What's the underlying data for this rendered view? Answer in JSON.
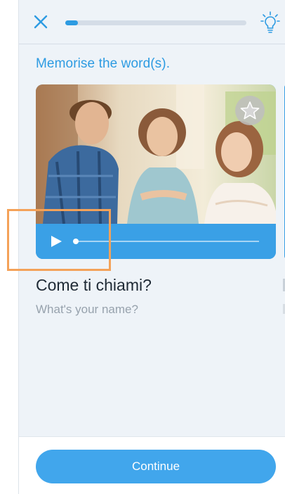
{
  "header": {
    "close_icon": "close-icon",
    "hint_icon": "lightbulb-icon",
    "progress": 0.07
  },
  "lesson": {
    "instruction": "Memorise the word(s).",
    "word": "Come ti chiami?",
    "translation": "What's your name?"
  },
  "media": {
    "image_icon": "photo-three-people-talking",
    "favorite_icon": "star-icon",
    "play_icon": "play-icon",
    "audio_progress": 0.0
  },
  "footer": {
    "continue_label": "Continue"
  },
  "colors": {
    "accent": "#2d9be2",
    "button": "#41a6ec",
    "background": "#eef3f8",
    "highlight": "#f4a259"
  }
}
